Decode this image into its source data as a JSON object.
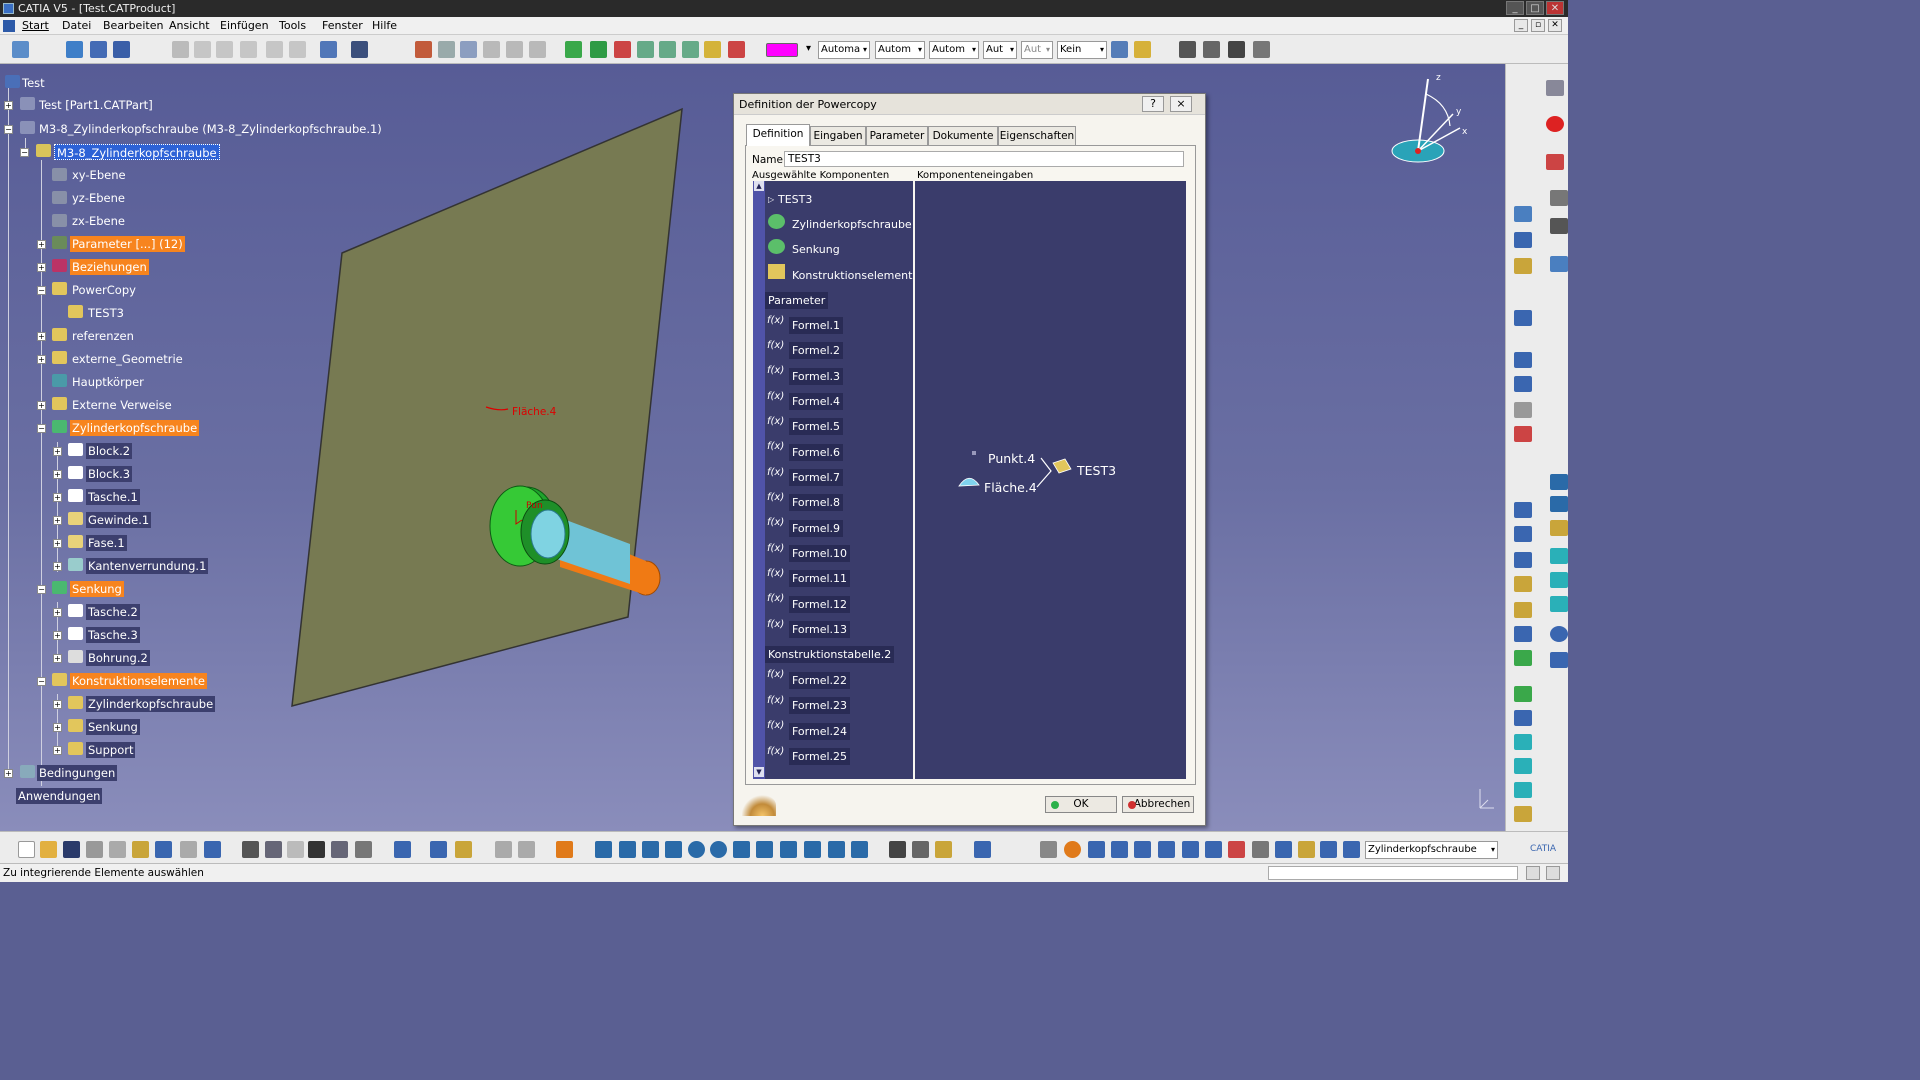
{
  "window": {
    "title": "CATIA V5 - [Test.CATProduct]"
  },
  "menu": [
    "Start",
    "Datei",
    "Bearbeiten",
    "Ansicht",
    "Einfügen",
    "Tools",
    "Fenster",
    "Hilfe"
  ],
  "toolbar_combos": [
    "Automa",
    "Autom",
    "Autom",
    "Aut",
    "Aut",
    "Kein"
  ],
  "color_swatch": "#ff00ff",
  "tree": {
    "root": "Test",
    "part1": "Test [Part1.CATPart]",
    "part2": "M3-8_Zylinderkopfschraube (M3-8_Zylinderkopfschraube.1)",
    "partbody": "M3-8_Zylinderkopfschraube",
    "xy": "xy-Ebene",
    "yz": "yz-Ebene",
    "zx": "zx-Ebene",
    "parameter": "Parameter [...] (12)",
    "relations": "Beziehungen",
    "powercopy": "PowerCopy",
    "test3": "TEST3",
    "ref": "referenzen",
    "extgeo": "externe_Geometrie",
    "mainbody": "Hauptkörper",
    "extref": "Externe Verweise",
    "zyl": "Zylinderkopfschraube",
    "block2": "Block.2",
    "block3": "Block.3",
    "tasche1": "Tasche.1",
    "gewinde1": "Gewinde.1",
    "fase1": "Fase.1",
    "kante1": "Kantenverrundung.1",
    "senkung": "Senkung",
    "tasche2": "Tasche.2",
    "tasche3": "Tasche.3",
    "bohrung2": "Bohrung.2",
    "konstr": "Konstruktionselemente",
    "k_zyl": "Zylinderkopfschraube",
    "k_senk": "Senkung",
    "k_support": "Support",
    "bedingungen": "Bedingungen",
    "anwendungen": "Anwendungen"
  },
  "viewport": {
    "label_flaeche": "Fläche.4",
    "label_punkt": "Pun"
  },
  "dialog": {
    "title": "Definition der Powercopy",
    "help": "?",
    "close": "×",
    "tabs": [
      "Definition",
      "Eingaben",
      "Parameter",
      "Dokumente",
      "Eigenschaften"
    ],
    "name_label": "Name:",
    "name_value": "TEST3",
    "col_left": "Ausgewählte Komponenten",
    "col_right": "Komponenteneingaben",
    "left_items": [
      "TEST3",
      "Zylinderkopfschraube",
      "Senkung",
      "Konstruktionselemente",
      "Parameter",
      "Formel.1",
      "Formel.2",
      "Formel.3",
      "Formel.4",
      "Formel.5",
      "Formel.6",
      "Formel.7",
      "Formel.8",
      "Formel.9",
      "Formel.10",
      "Formel.11",
      "Formel.12",
      "Formel.13",
      "Konstruktionstabelle.2",
      "Formel.22",
      "Formel.23",
      "Formel.24",
      "Formel.25"
    ],
    "graph": {
      "punkt": "Punkt.4",
      "flaeche": "Fläche.4",
      "target": "TEST3"
    },
    "ok": "OK",
    "cancel": "Abbrechen"
  },
  "bottom_combo": "Zylinderkopfschraube",
  "status": "Zu integrierende Elemente auswählen"
}
